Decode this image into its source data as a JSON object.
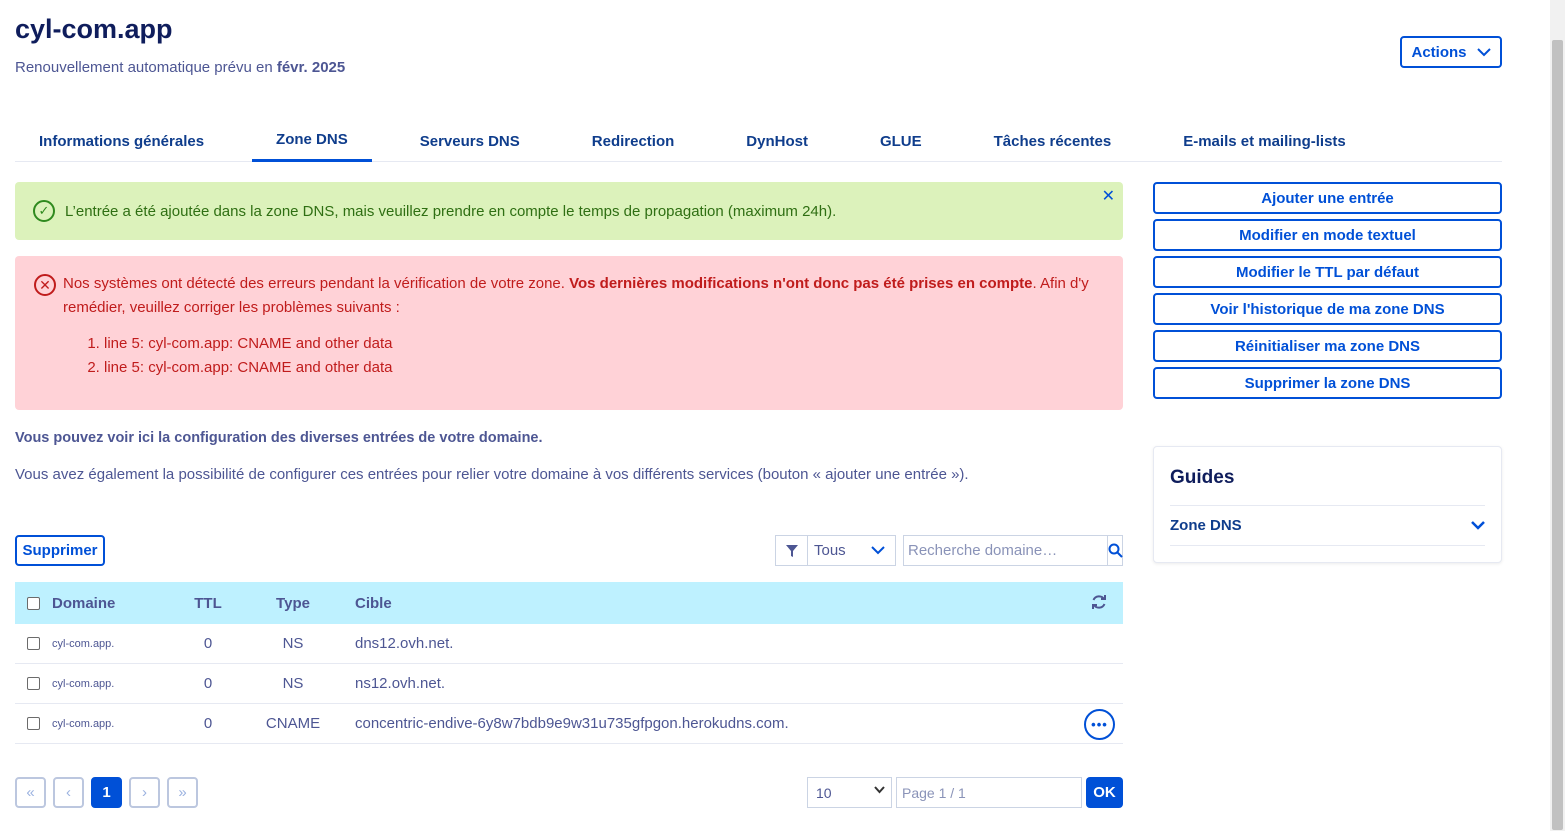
{
  "header": {
    "title": "cyl-com.app",
    "renew_text": "Renouvellement automatique prévu en ",
    "renew_date": "févr. 2025",
    "actions_label": "Actions"
  },
  "tabs": [
    {
      "label": "Informations générales"
    },
    {
      "label": "Zone DNS"
    },
    {
      "label": "Serveurs DNS"
    },
    {
      "label": "Redirection"
    },
    {
      "label": "DynHost"
    },
    {
      "label": "GLUE"
    },
    {
      "label": "Tâches récentes"
    },
    {
      "label": "E-mails et mailing-lists"
    }
  ],
  "alerts": {
    "success": "L’entrée a été ajoutée dans la zone DNS, mais veuillez prendre en compte le temps de propagation (maximum 24h).",
    "error_intro": "Nos systèmes ont détecté des erreurs pendant la vérification de votre zone. ",
    "error_bold": "Vos dernières modifications n'ont donc pas été prises en compte",
    "error_outro": ". Afin d'y remédier, veuillez corriger les problèmes suivants :",
    "error_items": [
      "line 5: cyl-com.app: CNAME and other data",
      "line 5: cyl-com.app: CNAME and other data"
    ]
  },
  "intro": {
    "bold": "Vous pouvez voir ici la configuration des diverses entrées de votre domaine.",
    "text": "Vous avez également la possibilité de configurer ces entrées pour relier votre domaine à vos différents services (bouton « ajouter une entrée »)."
  },
  "toolbar": {
    "delete_label": "Supprimer",
    "filter_value": "Tous",
    "search_placeholder": "Recherche domaine…"
  },
  "table": {
    "headers": {
      "domain": "Domaine",
      "ttl": "TTL",
      "type": "Type",
      "target": "Cible"
    },
    "rows": [
      {
        "domain": "cyl-com.app.",
        "ttl": "0",
        "type": "NS",
        "target": "dns12.ovh.net."
      },
      {
        "domain": "cyl-com.app.",
        "ttl": "0",
        "type": "NS",
        "target": "ns12.ovh.net."
      },
      {
        "domain": "cyl-com.app.",
        "ttl": "0",
        "type": "CNAME",
        "target": "concentric-endive-6y8w7bdb9e9w31u735gfpgon.herokudns.com."
      }
    ]
  },
  "pagination": {
    "first": "«",
    "prev": "‹",
    "current": "1",
    "next": "›",
    "last": "»",
    "page_size": "10",
    "page_placeholder": "Page 1 / 1",
    "ok_label": "OK"
  },
  "side_buttons": [
    {
      "label": "Ajouter une entrée"
    },
    {
      "label": "Modifier en mode textuel"
    },
    {
      "label": "Modifier le TTL par défaut"
    },
    {
      "label": "Voir l'historique de ma zone DNS"
    },
    {
      "label": "Réinitialiser ma zone DNS"
    },
    {
      "label": "Supprimer la zone DNS"
    }
  ],
  "guides": {
    "title": "Guides",
    "item": "Zone DNS"
  },
  "icons": {
    "success": "check-circle-icon",
    "error": "error-circle-icon",
    "close": "close-icon",
    "filter": "filter-icon",
    "search": "search-icon",
    "refresh": "refresh-icon",
    "more": "more-icon",
    "chevron": "chevron-down-icon"
  },
  "colors": {
    "primary": "#0050d7",
    "success_bg": "#dcf2bb",
    "error_bg": "#ffd2d7",
    "table_header_bg": "#bef1ff"
  }
}
